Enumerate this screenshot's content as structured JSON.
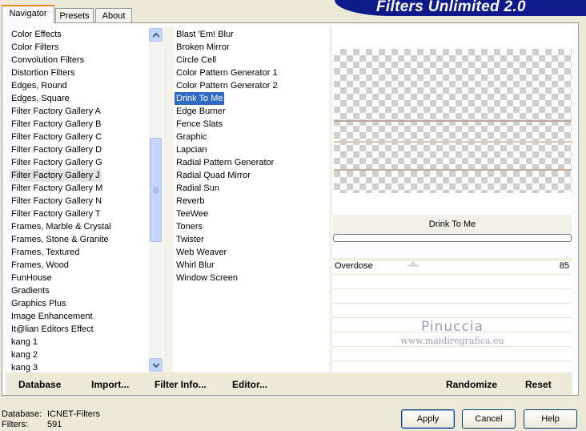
{
  "app": {
    "title": "Filters Unlimited 2.0"
  },
  "tabs": [
    {
      "label": "Navigator",
      "active": true
    },
    {
      "label": "Presets",
      "active": false
    },
    {
      "label": "About",
      "active": false
    }
  ],
  "categories": {
    "items": [
      "Color Effects",
      "Color Filters",
      "Convolution Filters",
      "Distortion Filters",
      "Edges, Round",
      "Edges, Square",
      "Filter Factory Gallery A",
      "Filter Factory Gallery B",
      "Filter Factory Gallery C",
      "Filter Factory Gallery D",
      "Filter Factory Gallery G",
      "Filter Factory Gallery J",
      "Filter Factory Gallery M",
      "Filter Factory Gallery N",
      "Filter Factory Gallery T",
      "Frames, Marble & Crystal",
      "Frames, Stone & Granite",
      "Frames, Textured",
      "Frames, Wood",
      "FunHouse",
      "Gradients",
      "Graphics Plus",
      "Image Enhancement",
      "It@lian Editors Effect",
      "kang 1",
      "kang 2",
      "kang 3"
    ],
    "selected": "Filter Factory Gallery J"
  },
  "filters": {
    "items": [
      "Blast 'Em! Blur",
      "Broken Mirror",
      "Circle Cell",
      "Color Pattern Generator 1",
      "Color Pattern Generator 2",
      "Drink To Me",
      "Edge Burner",
      "Fence Slats",
      "Graphic",
      "Lapcian",
      "Radial Pattern Generator",
      "Radial Quad Mirror",
      "Radial Sun",
      "Reverb",
      "TeeWee",
      "Toners",
      "Twister",
      "Web Weaver",
      "Whirl Blur",
      "Window Screen"
    ],
    "selected": "Drink To Me"
  },
  "preview": {
    "filter_name": "Drink To Me",
    "stripe_colors": [
      "#b9a89c",
      "#d9c6b5",
      "#c7ad98"
    ]
  },
  "params": {
    "name": "Overdose",
    "value": "85"
  },
  "watermark": {
    "name": "Pinuccia",
    "site": "www.maidiregrafica.eu"
  },
  "actions": {
    "database": "Database",
    "import": "Import...",
    "filter_info": "Filter Info...",
    "editor": "Editor...",
    "randomize": "Randomize",
    "reset": "Reset"
  },
  "footer": {
    "database_label": "Database:",
    "database_value": "ICNET-Filters",
    "filters_label": "Filters:",
    "filters_value": "591",
    "apply": "Apply",
    "cancel": "Cancel",
    "help": "Help"
  },
  "colors": {
    "title_banner": "#0e1a8a",
    "selection": "#316ac5",
    "tab_accent": "#e68b2c"
  }
}
